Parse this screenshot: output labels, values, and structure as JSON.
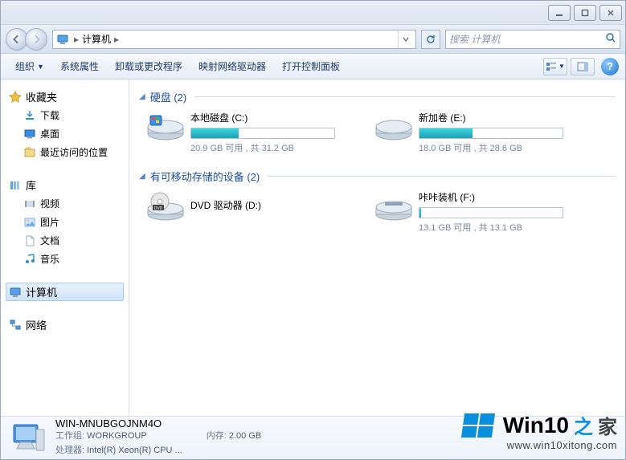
{
  "titlebar": {
    "min": "—",
    "max": "▢",
    "close": "✕"
  },
  "nav": {
    "crumb_root": "计算机",
    "search_placeholder": "搜索 计算机"
  },
  "toolbar": {
    "organize": "组织",
    "sysprops": "系统属性",
    "uninstall": "卸载或更改程序",
    "mapdrive": "映射网络驱动器",
    "controlpanel": "打开控制面板"
  },
  "sidebar": {
    "favorites": {
      "label": "收藏夹",
      "items": [
        {
          "label": "下载",
          "icon": "download-icon"
        },
        {
          "label": "桌面",
          "icon": "desktop-icon"
        },
        {
          "label": "最近访问的位置",
          "icon": "recent-icon"
        }
      ]
    },
    "libraries": {
      "label": "库",
      "items": [
        {
          "label": "视频",
          "icon": "video-icon"
        },
        {
          "label": "图片",
          "icon": "picture-icon"
        },
        {
          "label": "文档",
          "icon": "document-icon"
        },
        {
          "label": "音乐",
          "icon": "music-icon"
        }
      ]
    },
    "computer": {
      "label": "计算机"
    },
    "network": {
      "label": "网络"
    }
  },
  "groups": {
    "hdd": {
      "title": "硬盘 (2)",
      "drives": [
        {
          "label": "本地磁盘 (C:)",
          "info": "20.9 GB 可用 , 共 31.2 GB",
          "fill_pct": 33,
          "type": "hdd"
        },
        {
          "label": "新加卷 (E:)",
          "info": "18.0 GB 可用 , 共 28.6 GB",
          "fill_pct": 37,
          "type": "hdd"
        }
      ]
    },
    "removable": {
      "title": "有可移动存储的设备 (2)",
      "drives": [
        {
          "label": "DVD 驱动器 (D:)",
          "info": "",
          "fill_pct": null,
          "type": "dvd"
        },
        {
          "label": "咔咔装机 (F:)",
          "info": "13.1 GB 可用 , 共 13.1 GB",
          "fill_pct": 1,
          "type": "removable"
        }
      ]
    }
  },
  "details": {
    "name": "WIN-MNUBGOJNM4O",
    "workgroup_key": "工作组:",
    "workgroup_val": "WORKGROUP",
    "cpu_key": "处理器:",
    "cpu_val": "Intel(R) Xeon(R) CPU ...",
    "mem_key": "内存:",
    "mem_val": "2.00 GB"
  },
  "watermark": {
    "brand": "Win10",
    "zhi": " 之",
    "jia": "家",
    "url": "www.win10xitong.com"
  }
}
